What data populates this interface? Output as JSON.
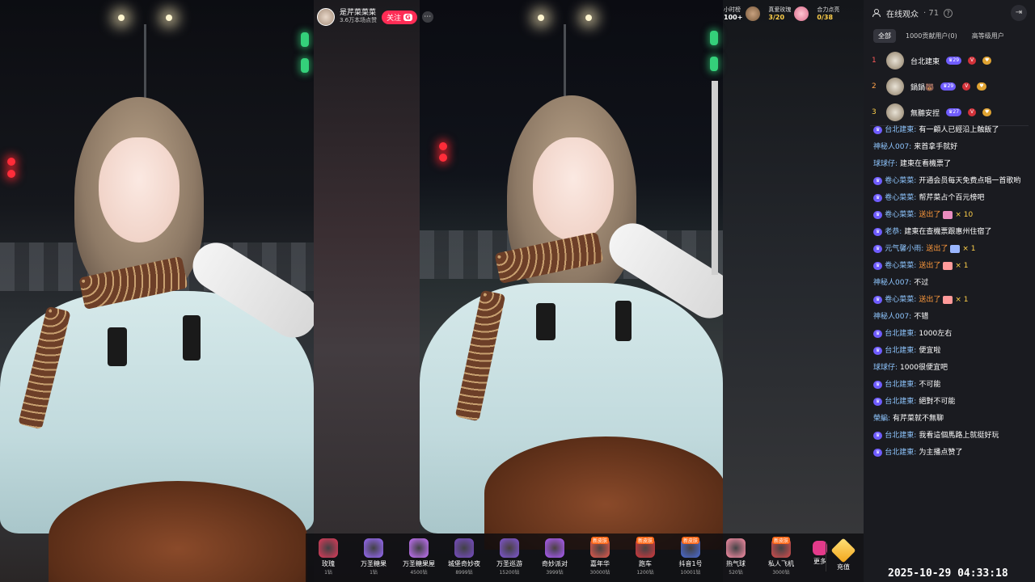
{
  "host": {
    "name": "是芹菜菜菜",
    "sub": "3.6万本场点赞",
    "follow_label": "关注",
    "follow_badge": "G"
  },
  "stats": [
    {
      "label": "小时榜",
      "value": "100+"
    },
    {
      "label": "真爱玫瑰",
      "value": "3/20"
    },
    {
      "label": "合力点亮",
      "value": "0/38"
    }
  ],
  "gifts": [
    {
      "name": "玫瑰",
      "price": "1钻",
      "tag": "",
      "color": "#e23a5a"
    },
    {
      "name": "万圣糖果",
      "price": "1钻",
      "tag": "",
      "color": "#9b6bff"
    },
    {
      "name": "万圣糖果屋",
      "price": "4500钻",
      "tag": "",
      "color": "#c873ff"
    },
    {
      "name": "城堡奇妙夜",
      "price": "8999钻",
      "tag": "",
      "color": "#7a4cc9"
    },
    {
      "name": "万圣巡游",
      "price": "15200钻",
      "tag": "",
      "color": "#8256d6"
    },
    {
      "name": "奇妙派对",
      "price": "3999钻",
      "tag": "",
      "color": "#b15cff"
    },
    {
      "name": "嘉年华",
      "price": "30000钻",
      "tag": "新皮肤",
      "color": "#e85a4c"
    },
    {
      "name": "跑车",
      "price": "1200钻",
      "tag": "新皮肤",
      "color": "#d8383d"
    },
    {
      "name": "抖音1号",
      "price": "10001钻",
      "tag": "新皮肤",
      "color": "#4a6bd6"
    },
    {
      "name": "热气球",
      "price": "520钻",
      "tag": "",
      "color": "#ff8fa8"
    },
    {
      "name": "私人飞机",
      "price": "3000钻",
      "tag": "新皮肤",
      "color": "#d84c4c"
    }
  ],
  "gift_more": "更多",
  "recharge": "充值",
  "sidebar": {
    "title": "在线观众",
    "count": "· 71",
    "tabs": [
      "全部",
      "1000贡献用户(0)",
      "高等级用户"
    ],
    "rank": [
      {
        "n": "1",
        "name": "台北建東",
        "lv": "29",
        "color": "#ff5a5a"
      },
      {
        "n": "2",
        "name": "鍋鍋🐻",
        "lv": "29",
        "color": "#ffa24a"
      },
      {
        "n": "3",
        "name": "無聽安捏",
        "lv": "27",
        "color": "#ffd04a"
      }
    ]
  },
  "chat": [
    {
      "user": "台北建東:",
      "text": "有一顧人已經沿上触飯了",
      "badges": [
        "lv"
      ]
    },
    {
      "user": "神秘人007:",
      "text": "来首拿手就好",
      "badges": []
    },
    {
      "user": "球球仔:",
      "text": "建東在看機票了",
      "badges": []
    },
    {
      "user": "卷心菜菜:",
      "text": "开通会员每天免费点唱一首歌哟",
      "badges": [
        "lv"
      ]
    },
    {
      "user": "卷心菜菜:",
      "text": "帮芹菜占个百元榜吧",
      "badges": [
        "lv"
      ]
    },
    {
      "user": "卷心菜菜:",
      "text": "送出了",
      "gift": "× 10",
      "badges": [
        "lv"
      ]
    },
    {
      "user": "老恭:",
      "text": "建東在查機票跟惠州住宿了",
      "badges": [
        "lv"
      ]
    },
    {
      "user": "元气馨小雨:",
      "text": "送出了",
      "gift": "× 1",
      "badges": [
        "lv"
      ]
    },
    {
      "user": "卷心菜菜:",
      "text": "送出了",
      "gift": "× 1",
      "badges": [
        "lv"
      ]
    },
    {
      "user": "神秘人007:",
      "text": "不过",
      "badges": []
    },
    {
      "user": "卷心菜菜:",
      "text": "送出了",
      "gift": "× 1",
      "badges": [
        "lv"
      ]
    },
    {
      "user": "神秘人007:",
      "text": "不错",
      "badges": []
    },
    {
      "user": "台北建東:",
      "text": "1000左右",
      "badges": [
        "lv"
      ]
    },
    {
      "user": "台北建東:",
      "text": "便宜啦",
      "badges": [
        "lv"
      ]
    },
    {
      "user": "球球仔:",
      "text": "1000很便宜吧",
      "badges": []
    },
    {
      "user": "台北建東:",
      "text": "不可能",
      "badges": [
        "lv"
      ]
    },
    {
      "user": "台北建東:",
      "text": "絕對不可能",
      "badges": [
        "lv"
      ]
    },
    {
      "user": "榮編:",
      "text": "有芹菜就不無聊",
      "badges": []
    },
    {
      "user": "台北建東:",
      "text": "我看這個馬路上就挺好玩",
      "badges": [
        "lv"
      ]
    },
    {
      "user": "台北建東:",
      "text": "为主播点赞了",
      "badges": [
        "lv"
      ]
    }
  ],
  "timestamp": "2025-10-29 04:33:18"
}
